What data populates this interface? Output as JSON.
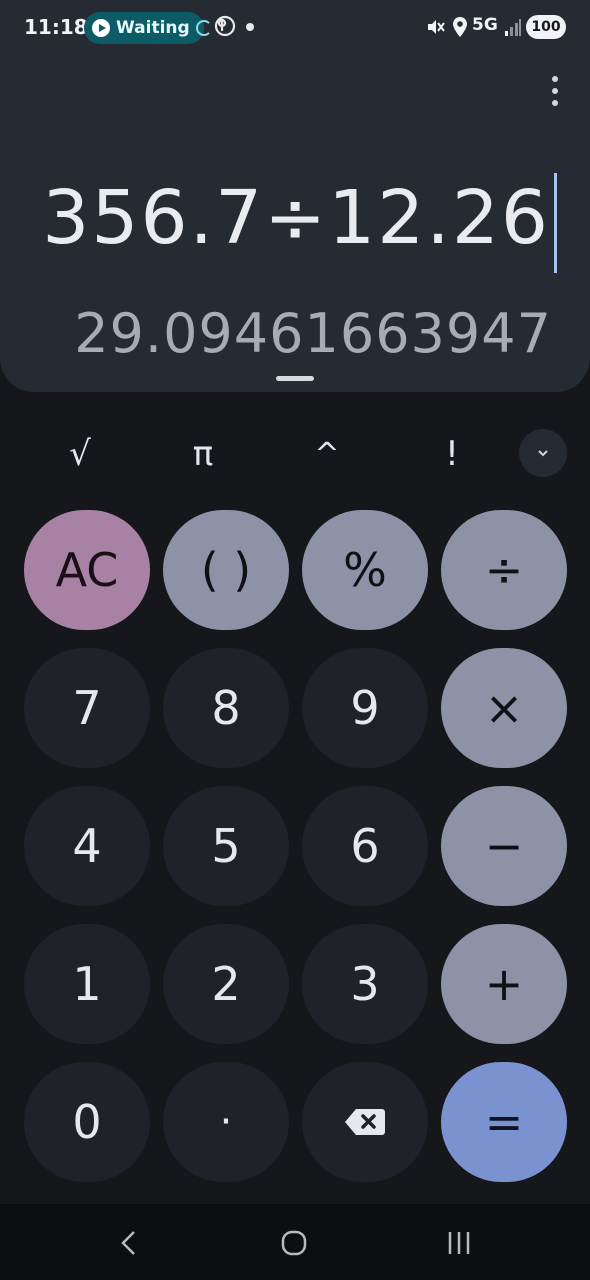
{
  "status_bar": {
    "time": "11:18",
    "waiting_label": "Waiting",
    "network": "5G",
    "battery": "100",
    "icons": [
      "play-icon",
      "loading-spinner-icon",
      "b-app-icon",
      "notification-dot-icon",
      "mute-icon",
      "location-icon",
      "signal-icon",
      "battery-icon"
    ]
  },
  "display": {
    "expression": "356.7÷12.26",
    "result": "29.09461663947"
  },
  "scientific_row": {
    "sqrt": "√",
    "pi": "π",
    "power": "^",
    "factorial": "!",
    "expand_icon": "chevron-down-icon"
  },
  "keypad": {
    "ac": "AC",
    "parens": "( )",
    "percent": "%",
    "divide": "÷",
    "seven": "7",
    "eight": "8",
    "nine": "9",
    "multiply": "×",
    "four": "4",
    "five": "5",
    "six": "6",
    "minus": "−",
    "one": "1",
    "two": "2",
    "three": "3",
    "plus": "+",
    "zero": "0",
    "decimal": "·",
    "backspace_icon": "backspace-icon",
    "equals": "="
  },
  "colors": {
    "display_bg": "#262a33",
    "app_bg": "#15171b",
    "operator_key": "#8d92a7",
    "ac_key": "#a882a4",
    "equals_key": "#7b92d1",
    "digit_key": "#1f2228"
  },
  "nav_bar": {
    "icons": [
      "back-icon",
      "home-icon",
      "recent-apps-icon"
    ]
  }
}
